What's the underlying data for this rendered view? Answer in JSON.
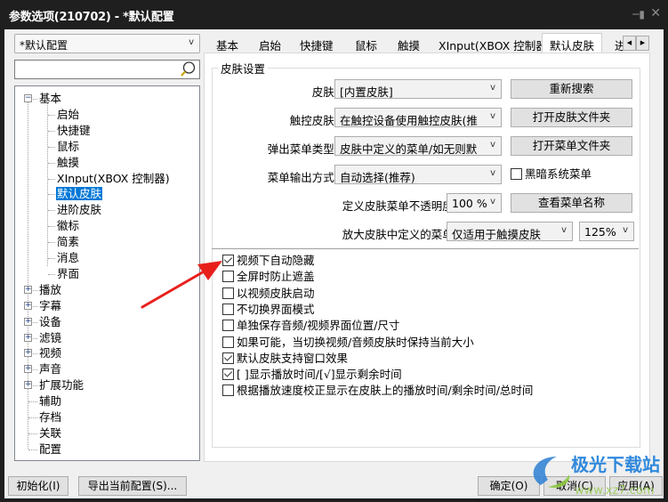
{
  "window": {
    "title": "参数选项(210702) - *默认配置",
    "pin_icon": "pin-icon",
    "close_icon": "close-icon"
  },
  "sidebar": {
    "profile_select": {
      "value": "*默认配置",
      "arrow": "v"
    },
    "search": {
      "placeholder": "",
      "value": "",
      "icon": "search-icon"
    },
    "tree": [
      {
        "label": "基本",
        "level": 0,
        "expander": "−",
        "expanded": true
      },
      {
        "label": "启始",
        "level": 1
      },
      {
        "label": "快捷键",
        "level": 1
      },
      {
        "label": "鼠标",
        "level": 1
      },
      {
        "label": "触摸",
        "level": 1
      },
      {
        "label": "XInput(XBOX 控制器)",
        "level": 1
      },
      {
        "label": "默认皮肤",
        "level": 1,
        "selected": true
      },
      {
        "label": "进阶皮肤",
        "level": 1
      },
      {
        "label": "徽标",
        "level": 1
      },
      {
        "label": "简素",
        "level": 1
      },
      {
        "label": "消息",
        "level": 1
      },
      {
        "label": "界面",
        "level": 1
      },
      {
        "label": "播放",
        "level": 0,
        "expander": "+"
      },
      {
        "label": "字幕",
        "level": 0,
        "expander": "+"
      },
      {
        "label": "设备",
        "level": 0,
        "expander": "+"
      },
      {
        "label": "滤镜",
        "level": 0,
        "expander": "+"
      },
      {
        "label": "视频",
        "level": 0,
        "expander": "+"
      },
      {
        "label": "声音",
        "level": 0,
        "expander": "+"
      },
      {
        "label": "扩展功能",
        "level": 0,
        "expander": "+"
      },
      {
        "label": "辅助",
        "level": 0
      },
      {
        "label": "存档",
        "level": 0
      },
      {
        "label": "关联",
        "level": 0
      },
      {
        "label": "配置",
        "level": 0
      }
    ]
  },
  "tabs": {
    "items": [
      "基本",
      "启始",
      "快捷键",
      "鼠标",
      "触摸",
      "XInput(XBOX 控制器)",
      "默认皮肤",
      "进"
    ],
    "active": "默认皮肤",
    "scroll_left": "◀",
    "scroll_right": "▶"
  },
  "skin_settings": {
    "group_title": "皮肤设置",
    "rows": {
      "skin": {
        "label": "皮肤:",
        "value": "[内置皮肤]",
        "button": "重新搜索"
      },
      "touch_skin": {
        "label": "触控皮肤:",
        "value": "在触控设备使用触控皮肤(推",
        "button": "打开皮肤文件夹"
      },
      "popup_menu": {
        "label": "弹出菜单类型:",
        "value": "皮肤中定义的菜单/如无则默",
        "button": "打开菜单文件夹"
      },
      "menu_output": {
        "label": "菜单输出方式:",
        "value": "自动选择(推荐)",
        "checkbox_label": "黑暗系统菜单",
        "checkbox_checked": false
      },
      "opacity": {
        "label": "定义皮肤菜单不透明度:",
        "value": "100 %",
        "button": "查看菜单名称"
      },
      "zoom_menu": {
        "label": "放大皮肤中定义的菜单:",
        "value": "仅适用于触摸皮肤",
        "scale": "125%"
      }
    },
    "combo_arrow": "v"
  },
  "options": [
    {
      "label": "视频下自动隐藏",
      "checked": true
    },
    {
      "label": "全屏时防止遮盖",
      "checked": false
    },
    {
      "label": "以视频皮肤启动",
      "checked": false
    },
    {
      "label": "不切换界面模式",
      "checked": false
    },
    {
      "label": "单独保存音频/视频界面位置/尺寸",
      "checked": false
    },
    {
      "label": "如果可能，当切换视频/音频皮肤时保持当前大小",
      "checked": false
    },
    {
      "label": "默认皮肤支持窗口效果",
      "checked": true
    },
    {
      "label": "[ ]显示播放时间/[√]显示剩余时间",
      "checked": true
    },
    {
      "label": "根据播放速度校正显示在皮肤上的播放时间/剩余时间/总时间",
      "checked": false
    }
  ],
  "footer": {
    "init_button": "初始化(I)",
    "export_button": "导出当前配置(S)...",
    "ok_button": "确定(O)",
    "cancel_button": "取消(C)",
    "apply_button": "应用(A)"
  },
  "annotation": {
    "type": "red-arrow",
    "color": "#e8201c",
    "points_to": "视频下自动隐藏"
  },
  "watermark": {
    "text": "极光下载站",
    "url_text": "www.xz7.com"
  }
}
